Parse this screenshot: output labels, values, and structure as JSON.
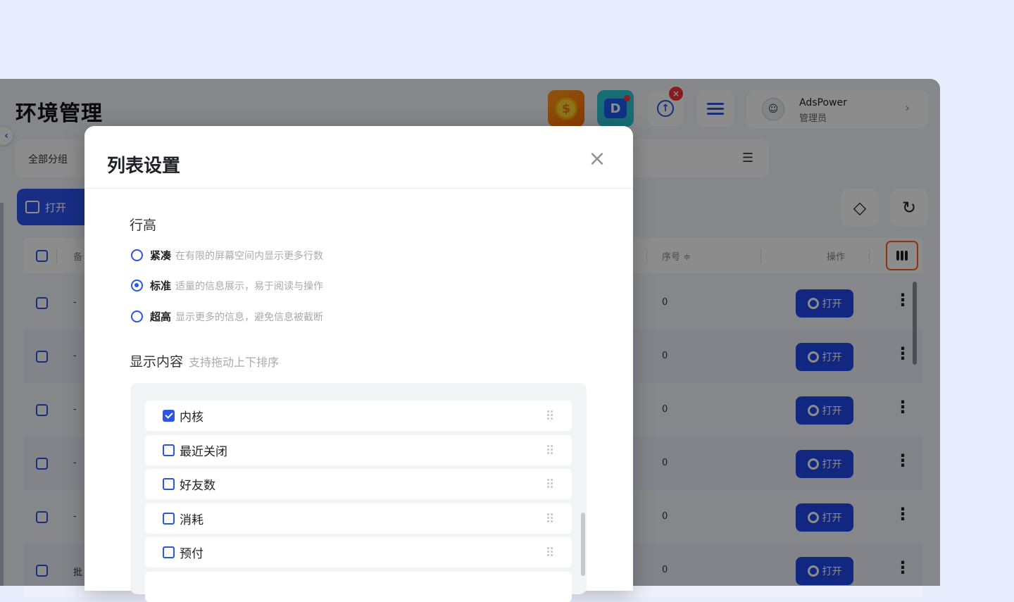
{
  "app": {
    "page_title": "环境管理",
    "group_label": "全部分组",
    "open_main": "打开",
    "profile": {
      "name": "AdsPower",
      "role": "管理员"
    },
    "update_badge": "×",
    "coin_symbol": "$",
    "sync_symbol": "D"
  },
  "table": {
    "headers": {
      "seq": "序号 ≑",
      "ops": "操作",
      "remark_partial": "备"
    },
    "rows": [
      {
        "name": "-",
        "seq": "0",
        "open": "打开"
      },
      {
        "name": "-",
        "seq": "0",
        "open": "打开"
      },
      {
        "name": "-",
        "seq": "0",
        "open": "打开"
      },
      {
        "name": "-",
        "seq": "0",
        "open": "打开"
      },
      {
        "name": "-",
        "seq": "0",
        "open": "打开"
      },
      {
        "name": "批",
        "seq": "0",
        "open": "打开"
      }
    ]
  },
  "modal": {
    "title": "列表设置",
    "close": "×",
    "row_height": {
      "label": "行高",
      "options": [
        {
          "label": "紧凑",
          "desc": "在有限的屏幕空间内显示更多行数",
          "selected": false
        },
        {
          "label": "标准",
          "desc": "适量的信息展示，易于阅读与操作",
          "selected": true
        },
        {
          "label": "超高",
          "desc": "显示更多的信息，避免信息被截断",
          "selected": false
        }
      ]
    },
    "display": {
      "label": "显示内容",
      "hint": "支持拖动上下排序",
      "items": [
        {
          "label": "内核",
          "checked": true
        },
        {
          "label": "最近关闭",
          "checked": false
        },
        {
          "label": "好友数",
          "checked": false
        },
        {
          "label": "消耗",
          "checked": false
        },
        {
          "label": "预付",
          "checked": false
        }
      ]
    }
  },
  "colors": {
    "primary": "#2a55e5",
    "highlight": "#ff5a1f",
    "background": "#e8edfe"
  }
}
